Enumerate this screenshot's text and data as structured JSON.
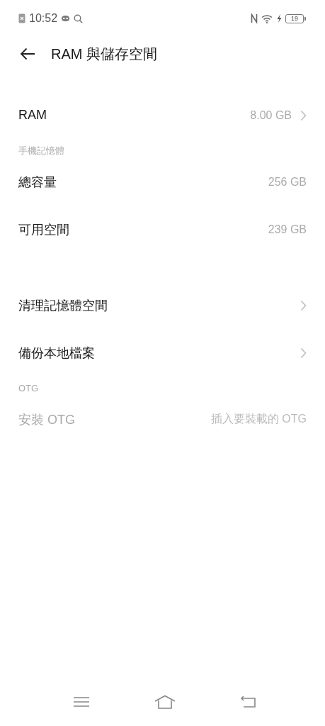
{
  "status_bar": {
    "time": "10:52",
    "battery": "19",
    "charging": true
  },
  "header": {
    "title": "RAM 與儲存空間"
  },
  "sections": [
    {
      "items": [
        {
          "kind": "link",
          "label": "RAM",
          "value": "8.00 GB",
          "disabled": false
        }
      ]
    },
    {
      "header": "手機記憶體",
      "items": [
        {
          "kind": "value",
          "label": "總容量",
          "value": "256 GB",
          "disabled": false
        },
        {
          "kind": "value",
          "label": "可用空間",
          "value": "239 GB",
          "disabled": false
        }
      ]
    },
    {
      "items": [
        {
          "kind": "link",
          "label": "清理記憶體空間",
          "disabled": false
        },
        {
          "kind": "link",
          "label": "備份本地檔案",
          "disabled": false
        }
      ]
    },
    {
      "header": "OTG",
      "items": [
        {
          "kind": "value",
          "label": "安裝 OTG",
          "value": "插入要裝載的 OTG",
          "disabled": true
        }
      ]
    }
  ]
}
